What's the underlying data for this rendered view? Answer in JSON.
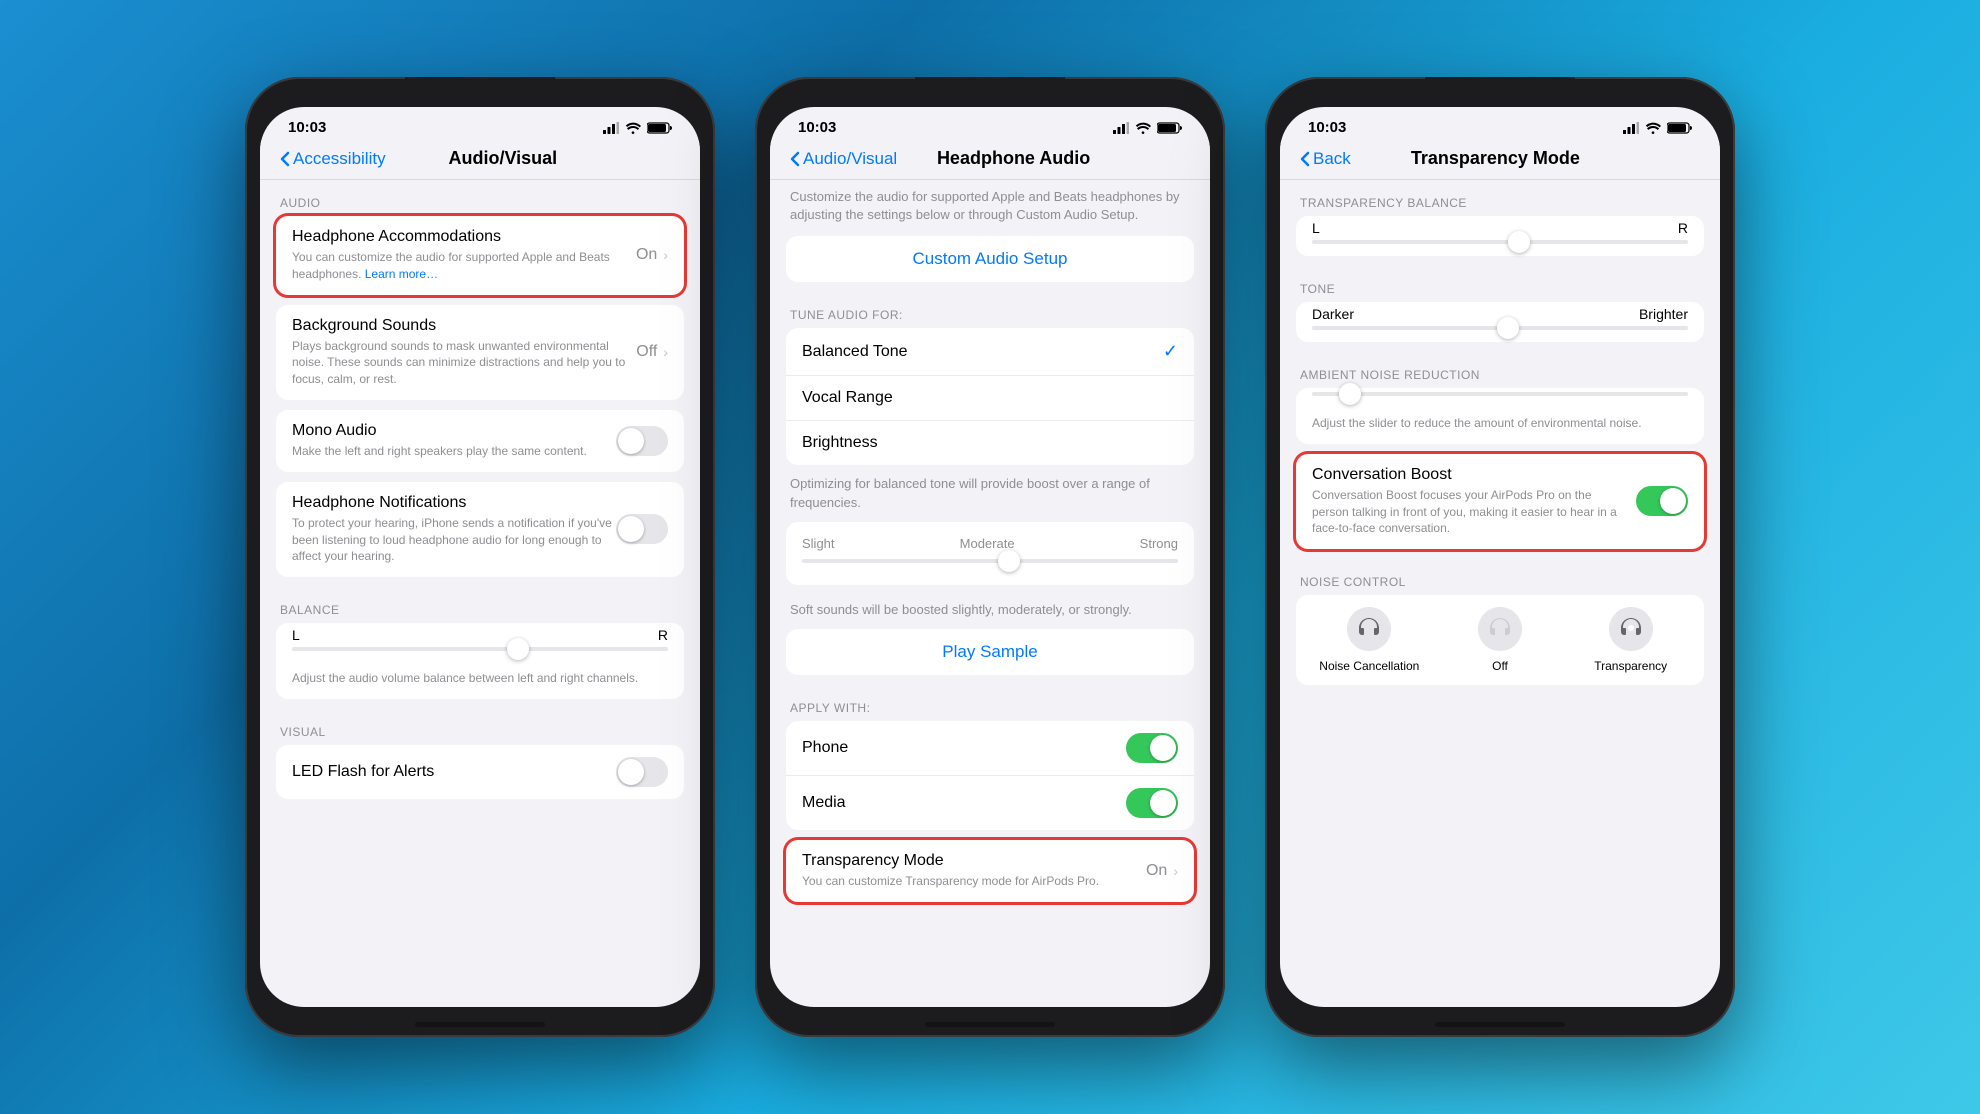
{
  "background": "#1a8fd1",
  "phones": [
    {
      "id": "phone1",
      "statusBar": {
        "time": "10:03",
        "signal": true,
        "wifi": true,
        "battery": true
      },
      "navBar": {
        "backLabel": "Accessibility",
        "backTarget": "Accessibility",
        "title": "Audio/Visual"
      },
      "sections": [
        {
          "label": "AUDIO",
          "groups": [
            {
              "highlighted": true,
              "rows": [
                {
                  "title": "Headphone Accommodations",
                  "value": "On",
                  "hasChevron": true,
                  "type": "nav",
                  "subtitle": "You can customize the audio for supported Apple and Beats headphones.",
                  "subtitleLink": "Learn more…"
                }
              ]
            },
            {
              "highlighted": false,
              "rows": [
                {
                  "title": "Background Sounds",
                  "value": "Off",
                  "hasChevron": true,
                  "type": "nav",
                  "subtitle": "Plays background sounds to mask unwanted environmental noise. These sounds can minimize distractions and help you to focus, calm, or rest."
                }
              ]
            },
            {
              "highlighted": false,
              "rows": [
                {
                  "title": "Mono Audio",
                  "type": "toggle",
                  "toggleOn": false,
                  "subtitle": "Make the left and right speakers play the same content."
                }
              ]
            },
            {
              "highlighted": false,
              "rows": [
                {
                  "title": "Headphone Notifications",
                  "type": "toggle",
                  "toggleOn": false,
                  "subtitle": "To protect your hearing, iPhone sends a notification if you've been listening to loud headphone audio for long enough to affect your hearing."
                }
              ]
            }
          ]
        },
        {
          "label": "BALANCE",
          "slider": {
            "leftLabel": "L",
            "rightLabel": "R",
            "thumbPosition": "60%",
            "description": "Adjust the audio volume balance between left and right channels."
          }
        },
        {
          "label": "VISUAL",
          "groups": [
            {
              "highlighted": false,
              "rows": [
                {
                  "title": "LED Flash for Alerts",
                  "type": "toggle",
                  "toggleOn": false
                }
              ]
            }
          ]
        }
      ]
    },
    {
      "id": "phone2",
      "statusBar": {
        "time": "10:03"
      },
      "navBar": {
        "backLabel": "Audio/Visual",
        "title": "Headphone Audio"
      },
      "topDescription": "Customize the audio for supported Apple and Beats headphones by adjusting the settings below or through Custom Audio Setup.",
      "customAudioBtn": "Custom Audio Setup",
      "tuneFor": {
        "label": "TUNE AUDIO FOR:",
        "options": [
          {
            "label": "Balanced Tone",
            "selected": true
          },
          {
            "label": "Vocal Range",
            "selected": false
          },
          {
            "label": "Brightness",
            "selected": false
          }
        ],
        "description": "Optimizing for balanced tone will provide boost over a range of frequencies."
      },
      "intensitySection": {
        "labels": [
          "Slight",
          "Moderate",
          "Strong"
        ],
        "thumbPosition": "55%"
      },
      "softSoundsDesc": "Soft sounds will be boosted slightly, moderately, or strongly.",
      "playSampleBtn": "Play Sample",
      "applyWith": {
        "label": "APPLY WITH:",
        "rows": [
          {
            "title": "Phone",
            "toggleOn": true
          },
          {
            "title": "Media",
            "toggleOn": true
          },
          {
            "title": "Transparency Mode",
            "value": "On",
            "hasChevron": true,
            "highlighted": true,
            "subtitle": "You can customize Transparency mode for AirPods Pro."
          }
        ]
      }
    },
    {
      "id": "phone3",
      "statusBar": {
        "time": "10:03"
      },
      "navBar": {
        "backLabel": "Back",
        "title": "Transparency Mode"
      },
      "transparencyBalance": {
        "label": "TRANSPARENCY BALANCE",
        "leftLabel": "L",
        "rightLabel": "R",
        "thumbPosition": "55%"
      },
      "tone": {
        "label": "TONE",
        "leftLabel": "Darker",
        "rightLabel": "Brighter",
        "thumbPosition": "52%"
      },
      "ambientNoise": {
        "label": "AMBIENT NOISE REDUCTION",
        "thumbPosition": "10%",
        "description": "Adjust the slider to reduce the amount of environmental noise."
      },
      "conversationBoost": {
        "highlighted": true,
        "title": "Conversation Boost",
        "toggleOn": true,
        "description": "Conversation Boost focuses your AirPods Pro on the person talking in front of you, making it easier to hear in a face-to-face conversation."
      },
      "noiseControl": {
        "label": "NOISE CONTROL",
        "options": [
          {
            "label": "Noise Cancellation",
            "icon": "🎧",
            "active": false
          },
          {
            "label": "Off",
            "icon": "🎧",
            "active": false
          },
          {
            "label": "Transparency",
            "icon": "🎧",
            "active": true
          }
        ]
      }
    }
  ]
}
